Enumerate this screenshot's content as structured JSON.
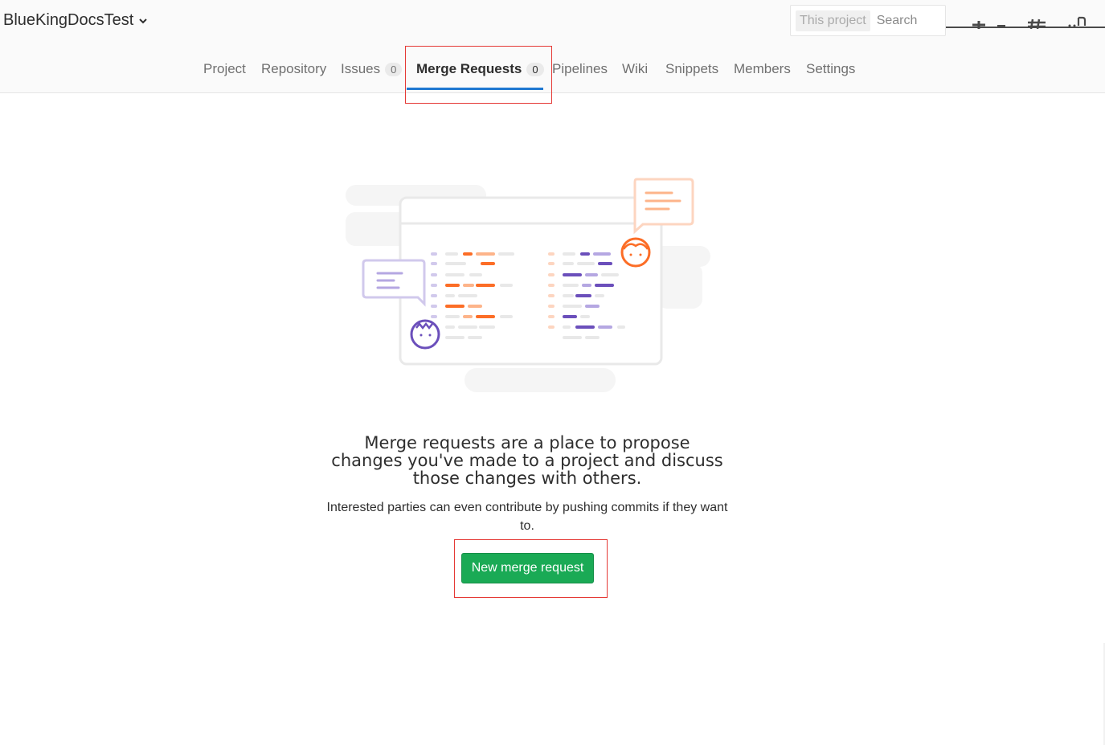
{
  "header": {
    "project_name": "BlueKingDocsTest",
    "search": {
      "scope": "This project",
      "placeholder": "Search"
    },
    "icons": [
      "plus-icon",
      "minus-icon",
      "hash-icon",
      "merge-request-icon"
    ]
  },
  "nav": {
    "tabs": [
      {
        "label": "Project"
      },
      {
        "label": "Repository"
      },
      {
        "label": "Issues",
        "count": "0"
      },
      {
        "label": "Merge Requests",
        "count": "0",
        "active": true
      },
      {
        "label": "Pipelines"
      },
      {
        "label": "Wiki"
      },
      {
        "label": "Snippets"
      },
      {
        "label": "Members"
      },
      {
        "label": "Settings"
      }
    ]
  },
  "empty_state": {
    "title": "Merge requests are a place to propose changes you've made to a project and discuss those changes with others.",
    "description": "Interested parties can even contribute by pushing commits if they want to.",
    "button_label": "New merge request"
  },
  "colors": {
    "accent_blue": "#1f78d1",
    "success_green": "#1aaa55",
    "highlight_red": "#e53935",
    "illustration_orange": "#fc6d26",
    "illustration_purple": "#6b4fbb"
  }
}
